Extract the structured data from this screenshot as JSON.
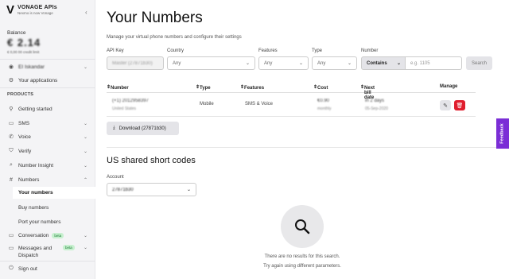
{
  "brand": {
    "name": "VONAGE APIs",
    "sub": "Nexmo is now Vonage"
  },
  "sidebar": {
    "balance_label": "Balance",
    "balance_value": "€ 2.14",
    "balance_sub": "€ 0,00 00 credit limit",
    "account": "EI Iskandar",
    "apps": "Your applications",
    "products_label": "PRODUCTS",
    "items": [
      {
        "label": "Getting started"
      },
      {
        "label": "SMS"
      },
      {
        "label": "Voice"
      },
      {
        "label": "Verify"
      },
      {
        "label": "Number Insight"
      },
      {
        "label": "Numbers"
      },
      {
        "label": "Your numbers"
      },
      {
        "label": "Buy numbers"
      },
      {
        "label": "Port your numbers"
      },
      {
        "label": "Conversation",
        "badge": "beta"
      },
      {
        "label": "Messages and Dispatch",
        "badge": "beta"
      }
    ],
    "signout": "Sign out"
  },
  "main": {
    "title": "Your Numbers",
    "subtitle": "Manage your virtual phone numbers and configure their settings",
    "filters": {
      "api_key_label": "API Key",
      "api_key_value": "Master (27871b30)",
      "country_label": "Country",
      "country_value": "Any",
      "features_label": "Features",
      "features_value": "Any",
      "type_label": "Type",
      "type_value": "Any",
      "number_label": "Number",
      "number_mode": "Contains",
      "number_placeholder": "e.g. 1105",
      "search_label": "Search"
    },
    "table": {
      "headers": [
        "Number",
        "Type",
        "Features",
        "Cost",
        "Next bill date",
        "Manage"
      ],
      "rows": [
        {
          "number": "(+1) 2012958397",
          "country": "United States",
          "type": "Mobile",
          "features": "SMS & Voice",
          "cost": "€0.90",
          "cost_sub": "monthly",
          "bill": "in 2 days",
          "bill_sub": "05-Sep-2020"
        }
      ]
    },
    "download_label": "Download (27871b30)",
    "short_codes_title": "US shared short codes",
    "account_label": "Account",
    "account_value": "27871b30",
    "empty_line1": "There are no results for this search.",
    "empty_line2": "Try again using different parameters."
  },
  "feedback_label": "Feedback"
}
